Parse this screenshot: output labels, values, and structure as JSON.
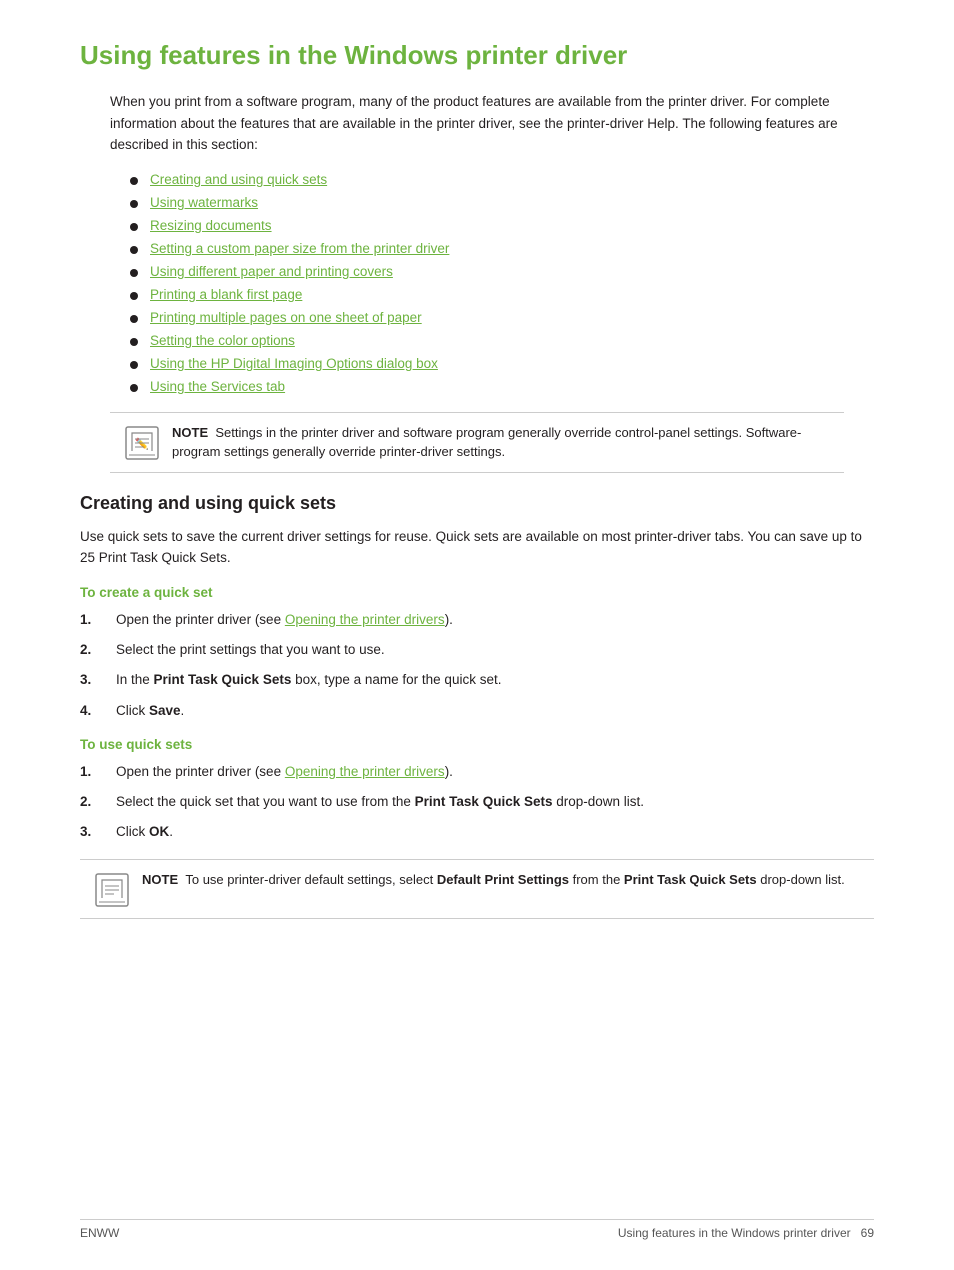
{
  "page": {
    "title": "Using features in the Windows printer driver",
    "intro": "When you print from a software program, many of the product features are available from the printer driver. For complete information about the features that are available in the printer driver, see the printer-driver Help. The following features are described in this section:",
    "links": [
      "Creating and using quick sets",
      "Using watermarks",
      "Resizing documents",
      "Setting a custom paper size from the printer driver",
      "Using different paper and printing covers",
      "Printing a blank first page",
      "Printing multiple pages on one sheet of paper",
      "Setting the color options",
      "Using the HP Digital Imaging Options dialog box",
      "Using the Services tab"
    ],
    "note1": {
      "label": "NOTE",
      "text": "Settings in the printer driver and software program generally override control-panel settings. Software-program settings generally override printer-driver settings."
    },
    "section1": {
      "title": "Creating and using quick sets",
      "intro": "Use quick sets to save the current driver settings for reuse. Quick sets are available on most printer-driver tabs. You can save up to 25 Print Task Quick Sets.",
      "subsection1": {
        "heading": "To create a quick set",
        "steps": [
          {
            "num": "1.",
            "text_before": "Open the printer driver (see ",
            "link": "Opening the printer drivers",
            "text_after": ")."
          },
          {
            "num": "2.",
            "text": "Select the print settings that you want to use."
          },
          {
            "num": "3.",
            "text_before": "In the ",
            "bold1": "Print Task Quick Sets",
            "text_middle": " box, type a name for the quick set.",
            "text_after": ""
          },
          {
            "num": "4.",
            "text_before": "Click ",
            "bold1": "Save",
            "text_after": "."
          }
        ]
      },
      "subsection2": {
        "heading": "To use quick sets",
        "steps": [
          {
            "num": "1.",
            "text_before": "Open the printer driver (see ",
            "link": "Opening the printer drivers",
            "text_after": ")."
          },
          {
            "num": "2.",
            "text_before": "Select the quick set that you want to use from the ",
            "bold1": "Print Task Quick Sets",
            "text_after": " drop-down list."
          },
          {
            "num": "3.",
            "text_before": "Click ",
            "bold1": "OK",
            "text_after": "."
          }
        ]
      },
      "note2": {
        "label": "NOTE",
        "text_before": "To use printer-driver default settings, select ",
        "bold1": "Default Print Settings",
        "text_middle": " from the ",
        "bold2": "Print Task Quick Sets",
        "text_after": " drop-down list."
      }
    }
  },
  "footer": {
    "left": "ENWW",
    "right": "Using features in the Windows printer driver",
    "page_num": "69"
  }
}
